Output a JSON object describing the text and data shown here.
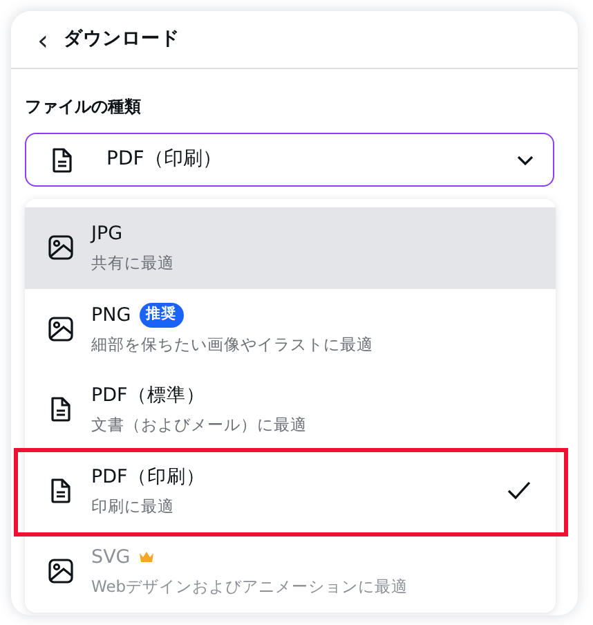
{
  "header": {
    "back": "‹",
    "title": "ダウンロード"
  },
  "file_type": {
    "label": "ファイルの種類",
    "value": "PDF（印刷）",
    "kind": "document"
  },
  "options": [
    {
      "kind": "image",
      "title": "JPG",
      "subtitle": "共有に最適",
      "hovered": true,
      "selected": false,
      "highlighted": false,
      "premium": false
    },
    {
      "kind": "image",
      "title": "PNG",
      "badge": "推奨",
      "subtitle": "細部を保ちたい画像やイラストに最適",
      "hovered": false,
      "selected": false,
      "highlighted": false,
      "premium": false
    },
    {
      "kind": "document",
      "title": "PDF（標準）",
      "subtitle": "文書（およびメール）に最適",
      "hovered": false,
      "selected": false,
      "highlighted": false,
      "premium": false
    },
    {
      "kind": "document",
      "title": "PDF（印刷）",
      "subtitle": "印刷に最適",
      "hovered": false,
      "selected": true,
      "highlighted": true,
      "premium": false
    },
    {
      "kind": "image",
      "title": "SVG",
      "subtitle": "Webデザインおよびアニメーションに最適",
      "hovered": false,
      "selected": false,
      "highlighted": false,
      "premium": true
    }
  ]
}
